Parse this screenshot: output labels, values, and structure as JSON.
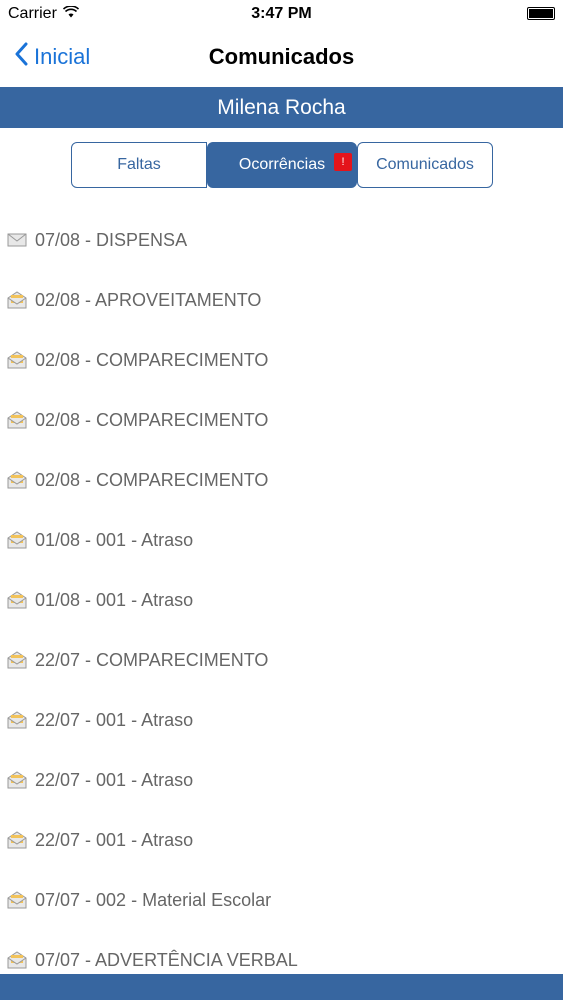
{
  "status_bar": {
    "carrier": "Carrier",
    "time": "3:47 PM",
    "wifi_icon": "wifi-icon",
    "battery_icon": "battery-icon"
  },
  "nav": {
    "back_label": "Inicial",
    "title": "Comunicados",
    "back_icon": "chevron-left-icon"
  },
  "student": {
    "name": "Milena Rocha"
  },
  "segments": {
    "items": [
      {
        "label": "Faltas"
      },
      {
        "label": "Ocorrências",
        "badge": "!"
      },
      {
        "label": "Comunicados"
      }
    ],
    "selected": "Ocorrências"
  },
  "messages": [
    {
      "text": "07/08 - DISPENSA",
      "icon": "envelope-closed-icon"
    },
    {
      "text": "02/08 - APROVEITAMENTO",
      "icon": "envelope-open-icon"
    },
    {
      "text": "02/08 - COMPARECIMENTO",
      "icon": "envelope-open-icon"
    },
    {
      "text": "02/08 - COMPARECIMENTO",
      "icon": "envelope-open-icon"
    },
    {
      "text": "02/08 - COMPARECIMENTO",
      "icon": "envelope-open-icon"
    },
    {
      "text": "01/08 - 001 - Atraso",
      "icon": "envelope-open-icon"
    },
    {
      "text": "01/08 - 001 - Atraso",
      "icon": "envelope-open-icon"
    },
    {
      "text": "22/07 - COMPARECIMENTO",
      "icon": "envelope-open-icon"
    },
    {
      "text": "22/07 - 001 - Atraso",
      "icon": "envelope-open-icon"
    },
    {
      "text": "22/07 - 001 - Atraso",
      "icon": "envelope-open-icon"
    },
    {
      "text": "22/07 - 001 - Atraso",
      "icon": "envelope-open-icon"
    },
    {
      "text": "07/07 - 002 - Material Escolar",
      "icon": "envelope-open-icon"
    },
    {
      "text": "07/07 - ADVERTÊNCIA VERBAL",
      "icon": "envelope-open-icon"
    }
  ],
  "colors": {
    "accent": "#3766a0",
    "link": "#1a73d8",
    "badge": "#e4141b",
    "item_text": "#666666"
  }
}
